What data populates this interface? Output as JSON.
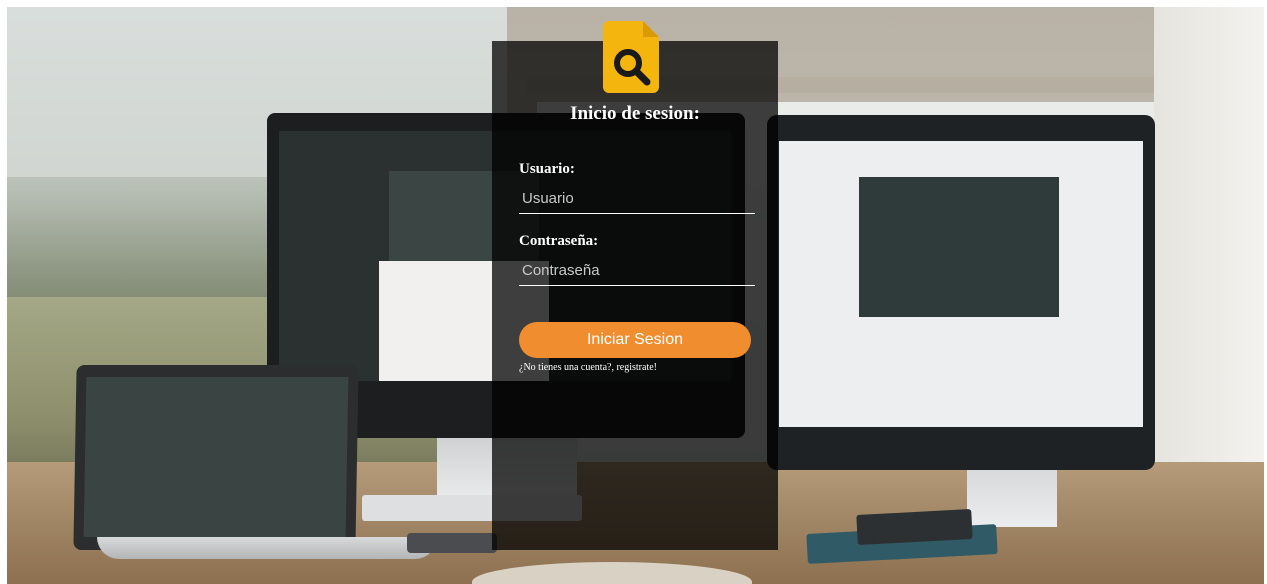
{
  "login": {
    "title": "Inicio de sesion:",
    "username_label": "Usuario:",
    "username_placeholder": "Usuario",
    "password_label": "Contraseña:",
    "password_placeholder": "Contraseña",
    "submit_label": "Iniciar Sesion",
    "register_text": "¿No tienes una cuenta?, registrate!"
  },
  "logo": {
    "icon": "search-document-icon",
    "color": "#f5b50f"
  },
  "colors": {
    "button": "#f08d2f",
    "overlay": "rgba(0,0,0,0.74)",
    "text": "#ffffff"
  }
}
